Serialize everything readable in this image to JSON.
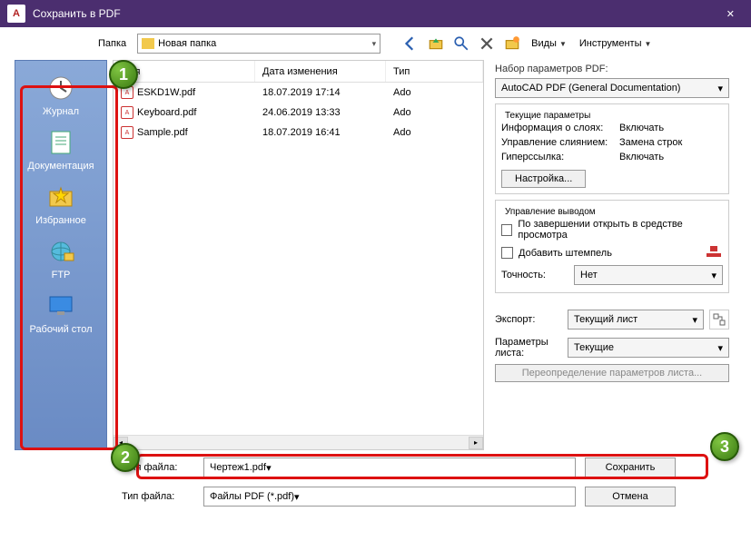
{
  "window": {
    "title": "Сохранить в PDF",
    "app_letter": "A"
  },
  "toolbar": {
    "folder_label": "Папка",
    "folder_value": "Новая папка",
    "views": "Виды",
    "tools": "Инструменты"
  },
  "sidebar": {
    "items": [
      {
        "label": "Журнал"
      },
      {
        "label": "Документация"
      },
      {
        "label": "Избранное"
      },
      {
        "label": "FTP"
      },
      {
        "label": "Рабочий стол"
      }
    ]
  },
  "file_list": {
    "cols": {
      "name": "Имя",
      "date": "Дата изменения",
      "type": "Тип"
    },
    "rows": [
      {
        "name": "ESKD1W.pdf",
        "date": "18.07.2019 17:14",
        "type": "Ado"
      },
      {
        "name": "Keyboard.pdf",
        "date": "24.06.2019 13:33",
        "type": "Ado"
      },
      {
        "name": "Sample.pdf",
        "date": "18.07.2019 16:41",
        "type": "Ado"
      }
    ]
  },
  "pdf_panel": {
    "preset_label": "Набор параметров PDF:",
    "preset_value": "AutoCAD PDF (General Documentation)",
    "current_params": "Текущие параметры",
    "params": [
      {
        "label": "Информация о слоях:",
        "value": "Включать"
      },
      {
        "label": "Управление слиянием:",
        "value": "Замена строк"
      },
      {
        "label": "Гиперссылка:",
        "value": "Включать"
      }
    ],
    "settings_btn": "Настройка...",
    "output_title": "Управление выводом",
    "open_after": "По завершении открыть в средстве просмотра",
    "add_stamp": "Добавить штемпель",
    "precision_label": "Точность:",
    "precision_value": "Нет",
    "export_label": "Экспорт:",
    "export_value": "Текущий лист",
    "sheet_params_label": "Параметры листа:",
    "sheet_params_value": "Текущие",
    "sheet_override": "Переопределение параметров листа..."
  },
  "bottom": {
    "filename_label": "Имя файла:",
    "filename_value": "Чертеж1.pdf",
    "filetype_label": "Тип файла:",
    "filetype_value": "Файлы PDF (*.pdf)",
    "save": "Сохранить",
    "cancel": "Отмена"
  },
  "callouts": {
    "c1": "1",
    "c2": "2",
    "c3": "3"
  }
}
